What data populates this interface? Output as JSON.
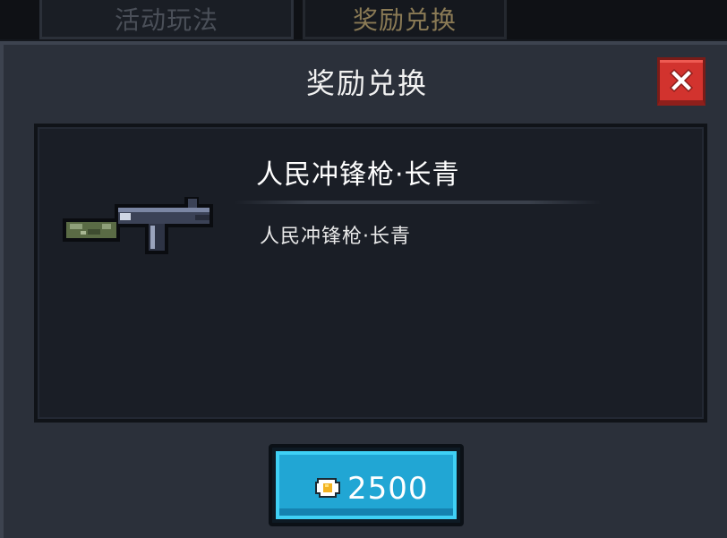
{
  "tabs": [
    {
      "label": "活动玩法"
    },
    {
      "label": "奖励兑换"
    }
  ],
  "dialog": {
    "title": "奖励兑换",
    "close_icon": "close-icon"
  },
  "item": {
    "name": "人民冲锋枪·长青",
    "description": "人民冲锋枪·长青",
    "icon": "smg-weapon-icon"
  },
  "purchase": {
    "price": "2500",
    "currency_icon": "fried-egg-coin-icon"
  },
  "colors": {
    "accent": "#21a6d4",
    "close": "#d2332e",
    "panel": "#1a1e26",
    "dialog": "#2b303a"
  }
}
